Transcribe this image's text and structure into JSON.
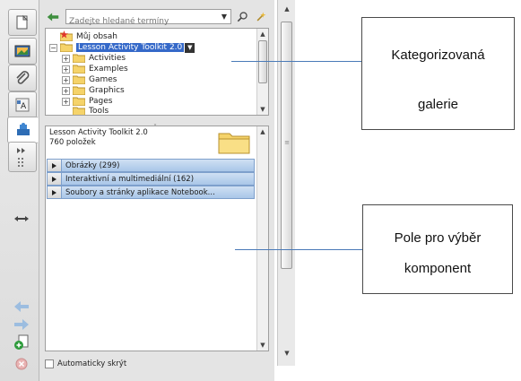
{
  "search": {
    "placeholder": "Zadejte hledané termíny"
  },
  "tree": {
    "items": [
      {
        "label": "Můj obsah"
      },
      {
        "label": "Lesson Activity Toolkit 2.0"
      },
      {
        "label": "Activities"
      },
      {
        "label": "Examples"
      },
      {
        "label": "Games"
      },
      {
        "label": "Graphics"
      },
      {
        "label": "Pages"
      },
      {
        "label": "Tools"
      }
    ]
  },
  "detail": {
    "title": "Lesson Activity Toolkit 2.0",
    "count": "760 položek",
    "categories": [
      {
        "label": "Obrázky (299)"
      },
      {
        "label": "Interaktivní a multimediální (162)"
      },
      {
        "label": "Soubory a stránky aplikace Notebook..."
      }
    ]
  },
  "autohide": {
    "label": "Automaticky skrýt",
    "checked": false
  },
  "annotations": {
    "gallery": {
      "line1": "Kategorizovaná",
      "line2": "galerie"
    },
    "components": {
      "line1": "Pole pro výběr",
      "line2": "komponent"
    }
  },
  "colors": {
    "selection": "#3569c9",
    "category_bar": "#a9c6e8",
    "callout_line": "#4a7ab8",
    "folder": "#f5d36a"
  },
  "icons": [
    "page-sorter-icon",
    "gallery-icon",
    "attachments-icon",
    "properties-icon",
    "addons-icon",
    "collapse-panel-icon",
    "resize-arrows-icon",
    "back-arrow-icon",
    "forward-arrow-icon",
    "add-page-icon",
    "delete-icon",
    "search-icon",
    "search-options-icon",
    "folder-icon",
    "star-icon"
  ]
}
